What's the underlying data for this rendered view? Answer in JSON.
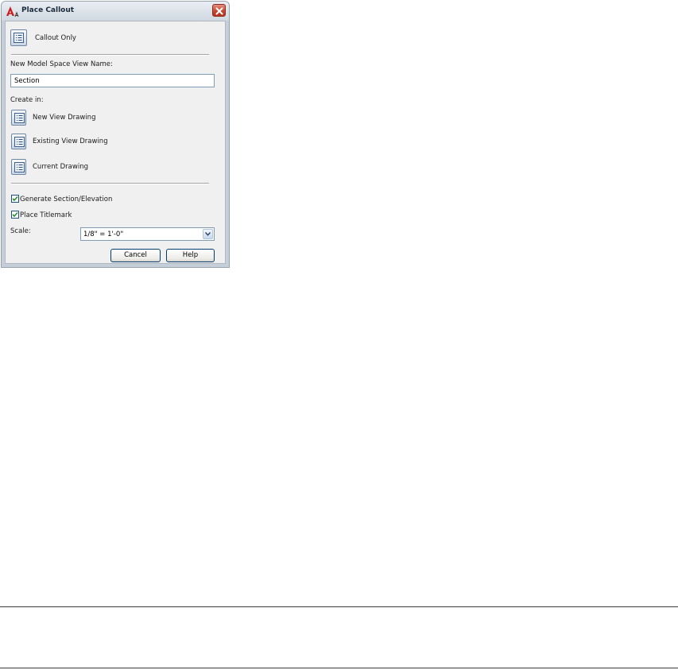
{
  "window": {
    "title": "Place Callout"
  },
  "callout_only": {
    "label": "Callout Only"
  },
  "view_name": {
    "label": "New Model Space View Name:",
    "value": "Section"
  },
  "create_in": {
    "label": "Create in:",
    "options": [
      {
        "label": "New View Drawing"
      },
      {
        "label": "Existing View Drawing"
      },
      {
        "label": "Current Drawing"
      }
    ]
  },
  "options": {
    "generate": {
      "label": "Generate Section/Elevation",
      "checked": true
    },
    "titlemark": {
      "label": "Place Titlemark",
      "checked": true
    }
  },
  "scale": {
    "label": "Scale:",
    "value": "1/8\" = 1'-0\""
  },
  "buttons": {
    "cancel": "Cancel",
    "help": "Help"
  },
  "colors": {
    "accent": "#2d8a2d",
    "close": "#c44a33"
  }
}
